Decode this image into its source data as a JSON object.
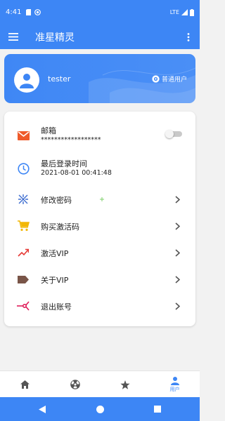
{
  "status_bar": {
    "time": "4:41",
    "network": "LTE",
    "left_icons": [
      "sim-card-icon",
      "notification-icon"
    ],
    "right_icons": [
      "signal-icon",
      "battery-icon"
    ]
  },
  "app_bar": {
    "title": "准星精灵",
    "menu_icon": "hamburger-menu-icon",
    "more_icon": "more-vert-icon"
  },
  "profile": {
    "username": "tester",
    "user_type": "普通用户",
    "avatar_icon": "person-icon",
    "user_type_icon": "gear-icon"
  },
  "list": {
    "email": {
      "label": "邮箱",
      "value": "******************",
      "icon": "mail-icon",
      "toggle_on": false
    },
    "last_login": {
      "label": "最后登录时间",
      "value": "2021-08-01 00:41:48",
      "icon": "clock-icon"
    },
    "change_password": {
      "label": "修改密码",
      "icon": "key-icon"
    },
    "buy_code": {
      "label": "购买激活码",
      "icon": "cart-icon"
    },
    "activate_vip": {
      "label": "激活VIP",
      "icon": "trending-icon"
    },
    "about_vip": {
      "label": "关于VIP",
      "icon": "tag-icon"
    },
    "logout": {
      "label": "退出账号",
      "icon": "logout-icon"
    }
  },
  "bottom_nav": {
    "tabs": [
      {
        "icon": "home-icon",
        "label": ""
      },
      {
        "icon": "radiation-icon",
        "label": ""
      },
      {
        "icon": "star-icon",
        "label": ""
      },
      {
        "icon": "person-icon",
        "label": "用户",
        "active": true
      }
    ]
  },
  "system_nav": [
    "back-icon",
    "home-circle-icon",
    "recents-icon"
  ],
  "colors": {
    "primary": "#3d86f5",
    "mail": "#ef5a2a",
    "clock": "#3d86f5",
    "key": "#3d6ccf",
    "cart": "#f2b705",
    "trending": "#e53935",
    "tag": "#795548",
    "logout": "#e01e5a"
  }
}
